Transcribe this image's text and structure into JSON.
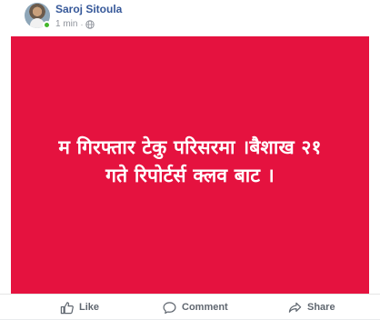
{
  "post": {
    "author": "Saroj Sitoula",
    "time": "1 min",
    "separator": "·",
    "privacy_icon": "globe-icon",
    "text_line1": "म गिरफ्तार टेकु परिसरमा ।बैशाख २१",
    "text_line2": "गते रिपोर्टर्स क्लव बाट ।",
    "background_color": "#e5123f"
  },
  "actions": {
    "like_label": "Like",
    "comment_label": "Comment",
    "share_label": "Share"
  }
}
